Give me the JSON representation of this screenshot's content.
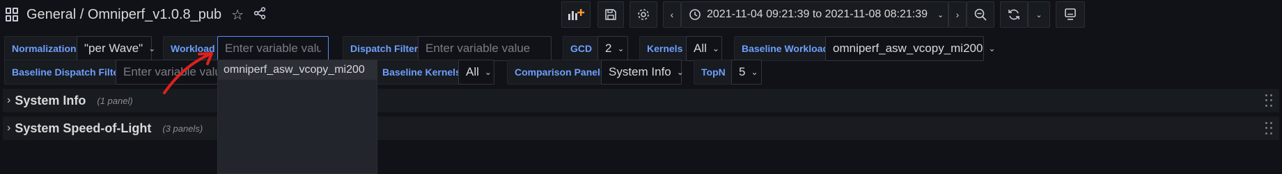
{
  "header": {
    "breadcrumb_folder": "General",
    "breadcrumb_sep": " / ",
    "dashboard_title": "Omniperf_v1.0.8_pub",
    "time_range": "2021-11-04 09:21:39 to 2021-11-08 08:21:39",
    "icons": [
      "grid-icon",
      "star-icon",
      "share-icon",
      "add-panel-icon",
      "save-icon",
      "settings-icon",
      "chevron-left-icon",
      "clock-icon",
      "chevron-down-icon",
      "chevron-right-icon",
      "zoom-out-icon",
      "refresh-icon",
      "chevron-down-icon",
      "tv-mode-icon"
    ]
  },
  "variables": {
    "normalization": {
      "label": "Normalization",
      "value": "\"per Wave\""
    },
    "workload": {
      "label": "Workload",
      "placeholder": "Enter variable value"
    },
    "dispatch_filter": {
      "label": "Dispatch Filter",
      "placeholder": "Enter variable value"
    },
    "gcd": {
      "label": "GCD",
      "value": "2"
    },
    "kernels": {
      "label": "Kernels",
      "value": "All"
    },
    "baseline_workload": {
      "label": "Baseline Workload",
      "value": "omniperf_asw_vcopy_mi200"
    },
    "baseline_dispatch_filter": {
      "label": "Baseline Dispatch Filter",
      "placeholder": "Enter variable value"
    },
    "baseline_kernels": {
      "label": "Baseline Kernels",
      "value": "All"
    },
    "comparison_panels": {
      "label": "Comparison Panels",
      "value": "System Info"
    },
    "topn": {
      "label": "TopN",
      "value": "5"
    }
  },
  "dropdown": {
    "options": [
      "omniperf_asw_vcopy_mi200"
    ]
  },
  "rows": [
    {
      "title": "System Info",
      "count": "(1 panel)"
    },
    {
      "title": "System Speed-of-Light",
      "count": "(3 panels)"
    }
  ],
  "colors": {
    "background": "#111217",
    "panel": "#181b1f",
    "label_blue": "#6e9fff",
    "focus_border": "#5b8fff",
    "annotation_red": "#e0201c"
  }
}
